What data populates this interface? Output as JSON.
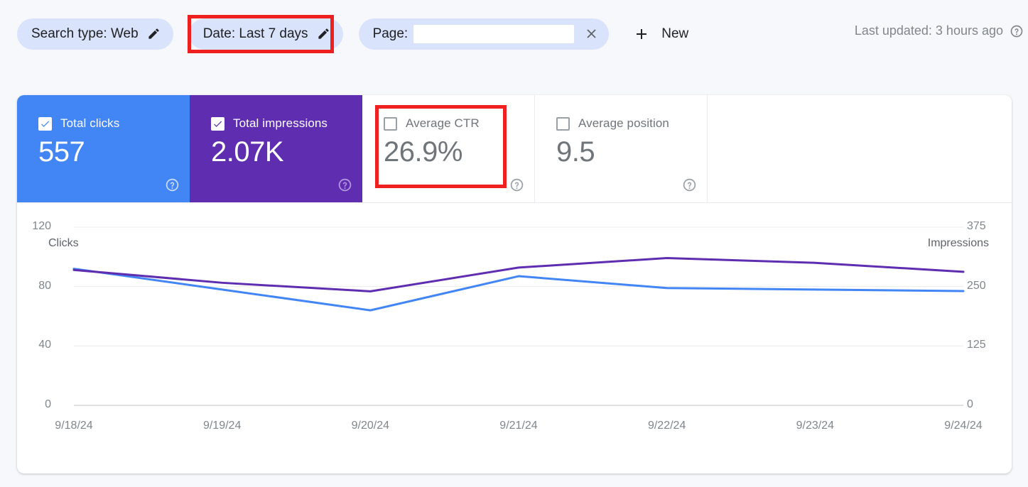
{
  "filter_bar": {
    "chips": [
      {
        "label": "Search type: Web",
        "icon": "pencil-icon",
        "highlighted": false
      },
      {
        "label": "Date: Last 7 days",
        "icon": "pencil-icon",
        "highlighted": true
      }
    ],
    "page_chip": {
      "label": "Page:",
      "value": "",
      "placeholder": "",
      "close_icon": "close-icon"
    },
    "new_button": {
      "label": "New",
      "icon": "plus-icon"
    },
    "last_updated": {
      "text": "Last updated: 3 hours ago",
      "icon": "help-icon"
    }
  },
  "metrics": [
    {
      "label": "Total clicks",
      "value": "557",
      "checked": true,
      "style": "blue",
      "color": "#4285f4",
      "help": "help-icon"
    },
    {
      "label": "Total impressions",
      "value": "2.07K",
      "checked": true,
      "style": "purple",
      "color": "#5f2eb0",
      "help": "help-icon"
    },
    {
      "label": "Average CTR",
      "value": "26.9%",
      "checked": false,
      "style": "plain",
      "color": "#70757a",
      "help": "help-icon",
      "highlighted": true
    },
    {
      "label": "Average position",
      "value": "9.5",
      "checked": false,
      "style": "plain",
      "color": "#70757a",
      "help": "help-icon"
    }
  ],
  "chart_data": {
    "type": "line",
    "title": "",
    "xlabel": "",
    "ylabel": "Clicks",
    "y2label": "Impressions",
    "x": [
      "9/18/24",
      "9/19/24",
      "9/20/24",
      "9/21/24",
      "9/22/24",
      "9/23/24",
      "9/24/24"
    ],
    "categories": [
      "9/18/24",
      "9/19/24",
      "9/20/24",
      "9/21/24",
      "9/22/24",
      "9/23/24",
      "9/24/24"
    ],
    "series": [
      {
        "name": "Clicks",
        "axis": "left",
        "color": "#4285f4",
        "values": [
          92,
          78,
          64,
          87,
          79,
          78,
          77
        ]
      },
      {
        "name": "Impressions",
        "axis": "right",
        "color": "#5f2eb0",
        "values": [
          285,
          258,
          240,
          290,
          310,
          300,
          281
        ]
      }
    ],
    "ylim": [
      0,
      120
    ],
    "yticks": [
      "120",
      "80",
      "40",
      "0"
    ],
    "y2lim": [
      0,
      375
    ],
    "y2ticks": [
      "375",
      "250",
      "125",
      "0"
    ],
    "grid": true,
    "legend": "none"
  },
  "colors": {
    "chip_bg": "#d9e3fb",
    "clicks": "#4285f4",
    "impressions": "#5f2eb0",
    "annotation": "#ef2020",
    "page_bg": "#f7f8fc"
  }
}
